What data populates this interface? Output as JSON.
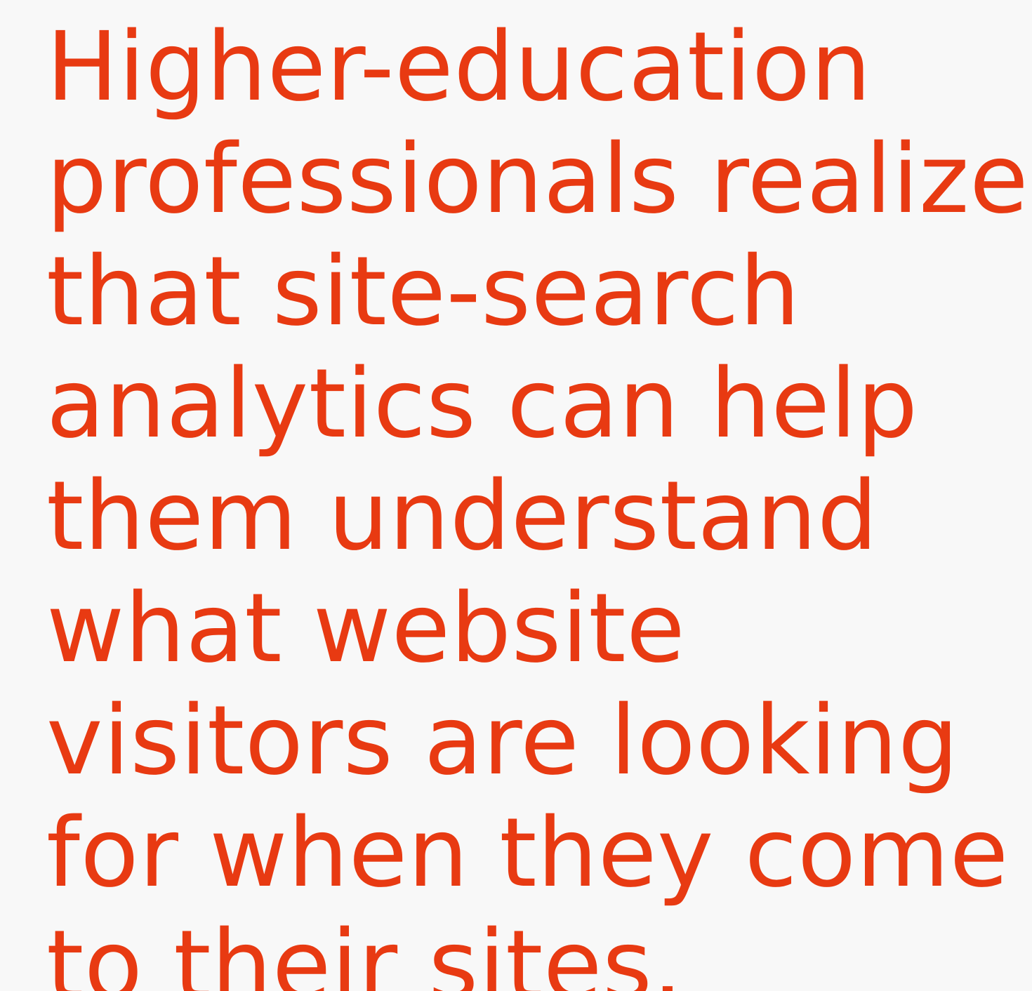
{
  "quote": {
    "lines": [
      "Higher-education",
      "professionals realize",
      "that site-search",
      "analytics can help",
      "them understand",
      "what website",
      "visitors are looking",
      "for when they come",
      "to their sites."
    ]
  },
  "colors": {
    "background": "#f8f8f8",
    "text": "#e83a12"
  }
}
